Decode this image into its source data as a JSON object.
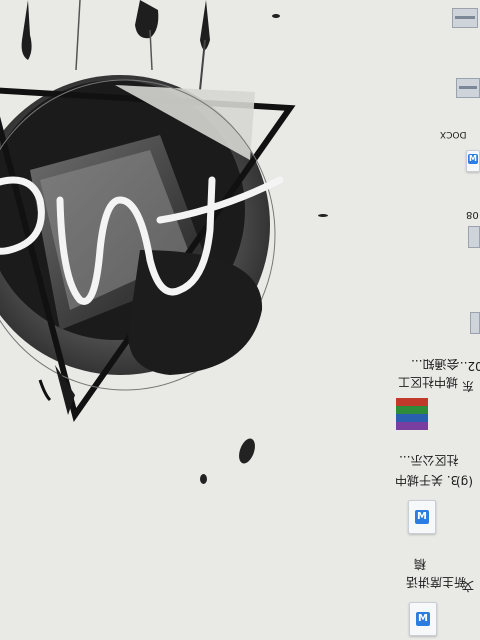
{
  "desktop": {
    "icons": [
      {
        "id": "doc1",
        "label_lines": [
          "新主席讲话",
          "稿"
        ],
        "type": "word-doc",
        "side_char": "文"
      },
      {
        "id": "doc2",
        "label_lines": [
          "3. 关于城中",
          "社区公示..."
        ],
        "type": "word-doc",
        "side_char": "(g)"
      },
      {
        "id": "rar1",
        "label_lines": [
          "城中社区工",
          "会通知..."
        ],
        "type": "winrar-archive",
        "side_char": "东"
      },
      {
        "id": "item4",
        "label_lines": [
          "02..."
        ],
        "type": "file"
      },
      {
        "id": "item5",
        "label_lines": [
          "08"
        ],
        "type": "thumbnail"
      },
      {
        "id": "item6",
        "label_lines": [
          "DOCX"
        ],
        "type": "word-doc"
      }
    ]
  },
  "wallpaper": {
    "logo_text": "pmf",
    "colors": {
      "background": "#e9e9e6",
      "ink": "#1a1a1a",
      "accent_blue": "#2b7de1"
    }
  }
}
